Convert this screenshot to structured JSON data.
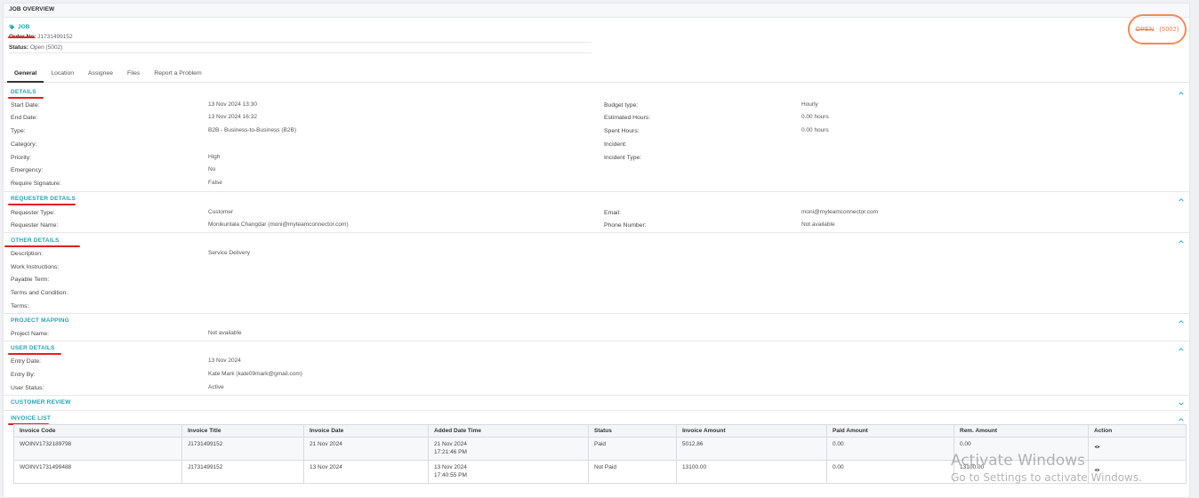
{
  "header": {
    "title": "JOB OVERVIEW"
  },
  "job": {
    "tag_label": "JOB",
    "order_label": "Order No:",
    "order_value": "J1731499152",
    "status_label": "Status:",
    "status_value": "Open (5002)",
    "status_pill_strike": "OPEN",
    "status_pill_code": "(5002)"
  },
  "tabs": [
    {
      "label": "General"
    },
    {
      "label": "Location"
    },
    {
      "label": "Assignee"
    },
    {
      "label": "Files"
    },
    {
      "label": "Report a Problem"
    }
  ],
  "details": {
    "title": "DETAILS",
    "left": [
      {
        "label": "Start Date:",
        "value": "13 Nov 2024 13:30"
      },
      {
        "label": "End Date:",
        "value": "13 Nov 2024 16:32"
      },
      {
        "label": "Type:",
        "value": "B2B - Business-to-Business (B2B)"
      },
      {
        "label": "Category:",
        "value": ""
      },
      {
        "label": "Priority:",
        "value": "High"
      },
      {
        "label": "Emergency:",
        "value": "No"
      },
      {
        "label": "Require Signature:",
        "value": "False"
      }
    ],
    "right": [
      {
        "label": "Budget type:",
        "value": "Hourly"
      },
      {
        "label": "Estimated Hours:",
        "value": "0.00 hours"
      },
      {
        "label": "Spent Hours:",
        "value": "0.00 hours"
      },
      {
        "label": "Incident:",
        "value": ""
      },
      {
        "label": "Incident Type:",
        "value": ""
      }
    ]
  },
  "requester": {
    "title": "REQUESTER DETAILS",
    "left": [
      {
        "label": "Requester Type:",
        "value": "Customer"
      },
      {
        "label": "Requester Name:",
        "value": "Monikuntala Changdar (moni@myteamconnector.com)"
      }
    ],
    "right": [
      {
        "label": "Email:",
        "value": "moni@myteamconnector.com"
      },
      {
        "label": "Phone Number:",
        "value": "Not available"
      }
    ]
  },
  "other": {
    "title": "OTHER DETAILS",
    "left": [
      {
        "label": "Description:",
        "value": "Service Delivery"
      },
      {
        "label": "Work Instructions:",
        "value": ""
      },
      {
        "label": "Payable Term:",
        "value": ""
      },
      {
        "label": "Terms and Condition:",
        "value": ""
      },
      {
        "label": "Terms:",
        "value": ""
      }
    ]
  },
  "project": {
    "title": "PROJECT MAPPING",
    "left": [
      {
        "label": "Project Name:",
        "value": "Not available"
      }
    ]
  },
  "user": {
    "title": "USER DETAILS",
    "left": [
      {
        "label": "Entry Date:",
        "value": "13 Nov 2024"
      },
      {
        "label": "Entry By:",
        "value": "Kate Mark (kate09mark@gmail.com)"
      },
      {
        "label": "User Status:",
        "value": "Active"
      }
    ]
  },
  "review": {
    "title": "CUSTOMER REVIEW"
  },
  "invoices": {
    "title": "INVOICE LIST",
    "columns": [
      "Invoice Code",
      "Invoice Title",
      "Invoice Date",
      "Added Date Time",
      "Status",
      "Invoice Amount",
      "Paid Amount",
      "Rem. Amount",
      "Action"
    ],
    "rows": [
      {
        "code": "WOINV1732189798",
        "title": "J1731499152",
        "date": "21 Nov 2024",
        "added_date": "21 Nov 2024",
        "added_time": "17:21:46 PM",
        "status": "Paid",
        "amount": "5012.86",
        "paid": "0.00",
        "rem": "0.00"
      },
      {
        "code": "WOINV1731499488",
        "title": "J1731499152",
        "date": "13 Nov 2024",
        "added_date": "13 Nov 2024",
        "added_time": "17:40:55 PM",
        "status": "Not Paid",
        "amount": "13100.00",
        "paid": "0.00",
        "rem": "13100.00"
      }
    ]
  },
  "watermark": {
    "line1": "Activate Windows",
    "line2": "Go to Settings to activate Windows."
  },
  "colors": {
    "accent": "#22a6b3",
    "pill": "#f0763f",
    "marker": "#e02020"
  }
}
